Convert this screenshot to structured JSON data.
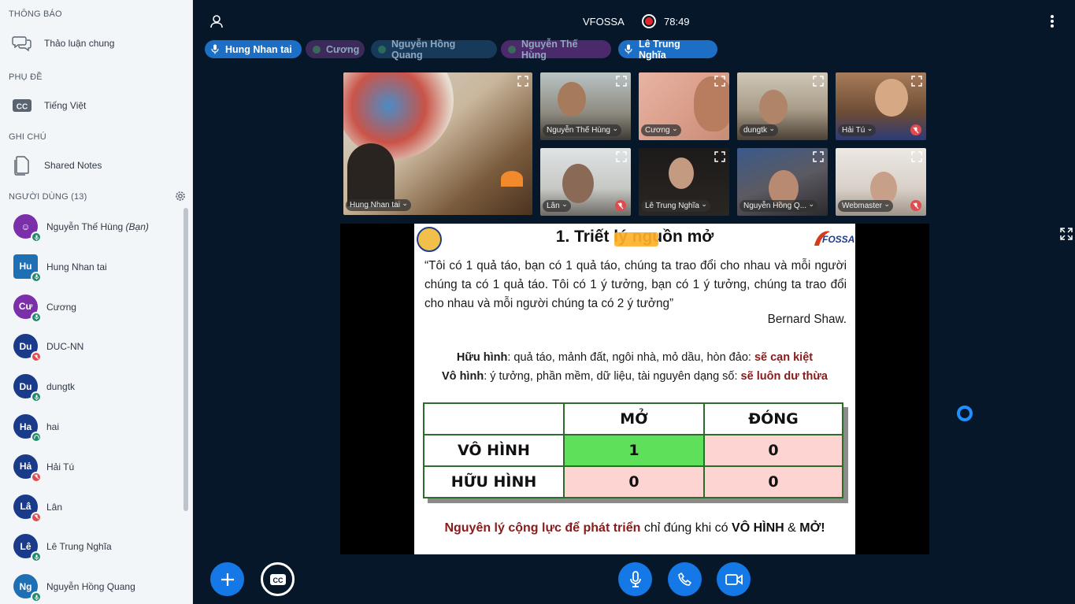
{
  "sidebar": {
    "notif_header": "THÔNG BÁO",
    "chat_label": "Thảo luận chung",
    "captions_header": "PHỤ ĐỀ",
    "captions_lang": "Tiếng Việt",
    "notes_header": "GHI CHÚ",
    "notes_label": "Shared Notes",
    "users_header": "NGƯỜI DÙNG (13)"
  },
  "users": [
    {
      "initials": "☺",
      "name": "Nguyễn Thế Hùng",
      "you": "(Bạn)",
      "color": "#7b2fa8",
      "status": "mic"
    },
    {
      "initials": "Hu",
      "name": "Hung Nhan tai",
      "color": "#1f6fb5",
      "status": "mic",
      "square": true
    },
    {
      "initials": "Cư",
      "name": "Cương",
      "color": "#7b2fa8",
      "status": "mic"
    },
    {
      "initials": "Du",
      "name": "DUC-NN",
      "color": "#1a3a8a",
      "status": "muted"
    },
    {
      "initials": "Du",
      "name": "dungtk",
      "color": "#1a3a8a",
      "status": "mic"
    },
    {
      "initials": "Ha",
      "name": "hai",
      "color": "#1a3a8a",
      "status": "listen"
    },
    {
      "initials": "Hả",
      "name": "Hải Tú",
      "color": "#1a3a8a",
      "status": "muted"
    },
    {
      "initials": "Lâ",
      "name": "Lân",
      "color": "#1a3a8a",
      "status": "muted"
    },
    {
      "initials": "Lê",
      "name": "Lê Trung Nghĩa",
      "color": "#1a3a8a",
      "status": "mic"
    },
    {
      "initials": "Ng",
      "name": "Nguyễn Hồng Quang",
      "color": "#1f6fb5",
      "status": "mic"
    }
  ],
  "topbar": {
    "title": "VFOSSA",
    "timer": "78:49"
  },
  "talkers": [
    {
      "name": "Hung Nhan tai",
      "active": true
    },
    {
      "name": "Cương",
      "active": false
    },
    {
      "name": "Nguyễn Hồng Quang",
      "active": false
    },
    {
      "name": "Nguyễn Thế Hùng",
      "active": false
    },
    {
      "name": "Lê Trung Nghĩa",
      "active": true
    }
  ],
  "tiles": {
    "t0": "Hung Nhan tai",
    "t1": "Nguyễn Thế Hùng",
    "t2": "Cương",
    "t3": "dungtk",
    "t4": "Hải Tú",
    "t5": "Lân",
    "t6": "Lê Trung Nghĩa",
    "t7": "Nguyễn Hồng Q...",
    "t8": "Webmaster"
  },
  "slide": {
    "title": "1. Triết lý nguồn mở",
    "quote": "“Tôi có 1 quả táo, bạn có 1 quả táo, chúng ta trao đổi cho nhau và mỗi người chúng ta có 1 quả táo. Tôi có 1 ý tưởng, bạn có 1 ý tưởng, chúng ta trao đổi cho nhau và mỗi người chúng ta có 2 ý tưởng”",
    "author": "Bernard Shaw.",
    "line1_label": "Hữu hình",
    "line1_text": ": quả táo, mảnh đất, ngôi nhà, mỏ dầu, hòn đảo: ",
    "line1_red": "sẽ cạn kiệt",
    "line2_label": "Vô hình",
    "line2_text": ": ý tưởng, phần mềm, dữ liệu, tài nguyên dạng số: ",
    "line2_red": "sẽ luôn dư thừa",
    "table": {
      "h1": "MỞ",
      "h2": "ĐÓNG",
      "r1": "VÔ HÌNH",
      "r1c1": "1",
      "r1c2": "0",
      "r2": "HỮU HÌNH",
      "r2c1": "0",
      "r2c2": "0"
    },
    "bottom_red": "Nguyên lý cộng lực để phát triển",
    "bottom_mid": " chỉ đúng khi có ",
    "bottom_b1": "VÔ HÌNH",
    "bottom_amp": " & ",
    "bottom_b2": "MỞ!",
    "logo_text": "FOSSA"
  },
  "colors": {
    "accent": "#1478e6",
    "green_cell": "#5fe05a",
    "pink_cell": "#fed4d3"
  }
}
